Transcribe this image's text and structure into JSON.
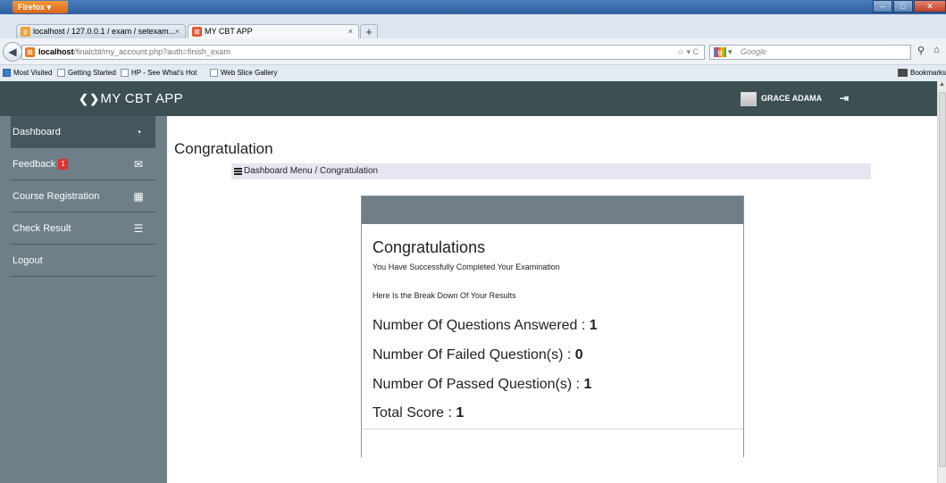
{
  "browser": {
    "menu_button": "Firefox ▾",
    "tabs": [
      {
        "label": "localhost / 127.0.0.1 / exam / setexam...",
        "icon": "phpmyadmin-icon"
      },
      {
        "label": "MY CBT APP",
        "icon": "app-favicon"
      }
    ],
    "url_host": "localhost",
    "url_path": "/finalcbt/my_account.php?auth=finish_exam",
    "search_placeholder": "Google",
    "bookmarks": [
      "Most Visited",
      "Getting Started",
      "HP - See What's Hot",
      "Web Slice Gallery"
    ],
    "bookmarks_menu": "Bookmarks"
  },
  "header": {
    "brand": "MY CBT APP",
    "user_name": "GRACE ADAMA"
  },
  "sidebar": {
    "items": [
      {
        "label": "Dashboard",
        "icon": "dashboard-icon"
      },
      {
        "label": "Feedback",
        "badge": "1",
        "icon": "envelope-icon"
      },
      {
        "label": "Course Registration",
        "icon": "grid-icon"
      },
      {
        "label": "Check Result",
        "icon": "list-icon"
      },
      {
        "label": "Logout"
      }
    ]
  },
  "main": {
    "page_title": "Congratulation",
    "breadcrumb": "Dashboard Menu / Congratulation",
    "card": {
      "heading": "Congratulations",
      "subheading": "You Have Successfully Completed Your Examination",
      "breakdown_intro": "Here Is the Break Down Of Your Results",
      "stats": [
        {
          "label": "Number Of Questions Answered : ",
          "value": "1"
        },
        {
          "label": "Number Of Failed Question(s) : ",
          "value": "0"
        },
        {
          "label": "Number Of Passed Question(s) : ",
          "value": "1"
        },
        {
          "label": "Total Score : ",
          "value": "1"
        }
      ]
    }
  },
  "colors": {
    "header_bg": "#3c4f53",
    "sidebar_bg": "#6e7f88",
    "sidebar_active": "#44575c",
    "card_header": "#6f7e87",
    "badge": "#e0312b"
  }
}
